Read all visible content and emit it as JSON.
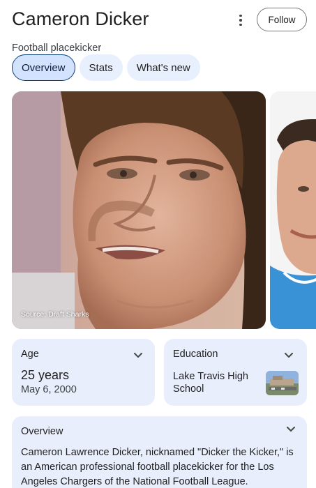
{
  "header": {
    "title": "Cameron Dicker",
    "subtitle": "Football placekicker",
    "follow_label": "Follow"
  },
  "tabs": [
    {
      "label": "Overview",
      "active": true
    },
    {
      "label": "Stats",
      "active": false
    },
    {
      "label": "What's new",
      "active": false
    }
  ],
  "gallery": {
    "credit": "Source: Draft Sharks"
  },
  "age_card": {
    "label": "Age",
    "value": "25 years",
    "date": "May 6, 2000"
  },
  "education_card": {
    "label": "Education",
    "value": "Lake Travis High School"
  },
  "overview_card": {
    "label": "Overview",
    "text": "Cameron Lawrence Dicker, nicknamed \"Dicker the Kicker,\" is an American professional football placekicker for the Los Angeles Chargers of the National Football League."
  },
  "colors": {
    "tab_bg": "#e8f0fe",
    "tab_active_bg": "#d3e3fd",
    "tab_active_border": "#0b3f7a",
    "card_bg": "#e8eefc"
  },
  "icons": [
    "more-vert-icon",
    "chevron-down-icon"
  ]
}
